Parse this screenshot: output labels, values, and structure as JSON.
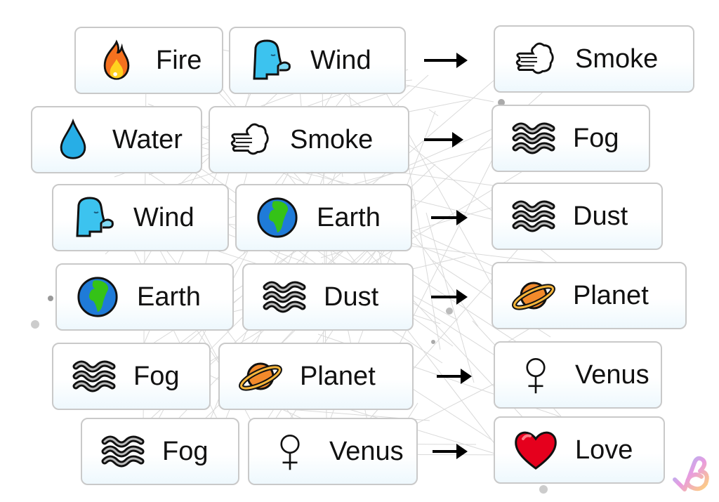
{
  "game": "Infinite Craft style combination chain",
  "recipes": [
    {
      "a": {
        "label": "Fire",
        "icon": "fire-icon"
      },
      "b": {
        "label": "Wind",
        "icon": "wind-face-icon"
      },
      "result": {
        "label": "Smoke",
        "icon": "smoke-icon"
      }
    },
    {
      "a": {
        "label": "Water",
        "icon": "water-drop-icon"
      },
      "b": {
        "label": "Smoke",
        "icon": "smoke-icon"
      },
      "result": {
        "label": "Fog",
        "icon": "fog-icon"
      }
    },
    {
      "a": {
        "label": "Wind",
        "icon": "wind-face-icon"
      },
      "b": {
        "label": "Earth",
        "icon": "earth-globe-icon"
      },
      "result": {
        "label": "Dust",
        "icon": "fog-icon"
      }
    },
    {
      "a": {
        "label": "Earth",
        "icon": "earth-globe-icon"
      },
      "b": {
        "label": "Dust",
        "icon": "fog-icon"
      },
      "result": {
        "label": "Planet",
        "icon": "ringed-planet-icon"
      }
    },
    {
      "a": {
        "label": "Fog",
        "icon": "fog-icon"
      },
      "b": {
        "label": "Planet",
        "icon": "ringed-planet-icon"
      },
      "result": {
        "label": "Venus",
        "icon": "venus-symbol-icon"
      }
    },
    {
      "a": {
        "label": "Fog",
        "icon": "fog-icon"
      },
      "b": {
        "label": "Venus",
        "icon": "venus-symbol-icon"
      },
      "result": {
        "label": "Love",
        "icon": "red-heart-icon"
      }
    }
  ],
  "watermark": {
    "icon": "brand-logo-icon"
  }
}
